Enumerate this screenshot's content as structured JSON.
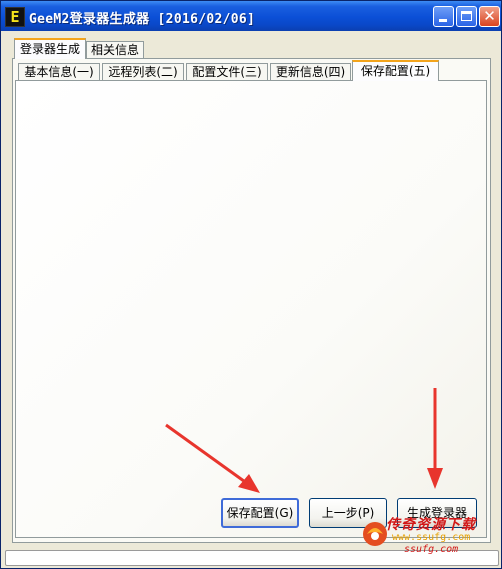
{
  "window": {
    "title": "GeeM2登录器生成器 [2016/02/06]",
    "icon_letter": "E",
    "minimize_glyph": "",
    "maximize_glyph": "",
    "close_glyph": "✕"
  },
  "outer_tabs": [
    {
      "label": "登录器生成",
      "active": true
    },
    {
      "label": "相关信息",
      "active": false
    }
  ],
  "inner_tabs": [
    {
      "label": "基本信息(一)",
      "active": false
    },
    {
      "label": "远程列表(二)",
      "active": false
    },
    {
      "label": "配置文件(三)",
      "active": false
    },
    {
      "label": "更新信息(四)",
      "active": false
    },
    {
      "label": "保存配置(五)",
      "active": true
    }
  ],
  "buttons": {
    "save": "保存配置(G)",
    "prev": "上一步(P)",
    "generate": "生成登录器"
  },
  "watermark": {
    "text": "传奇资源下载",
    "url": "www.ssufg.com",
    "url2": "ssufg.com"
  },
  "colors": {
    "titlebar": "#0b4fd6",
    "active_tab_accent": "#f3a41c",
    "arrow": "#e8352d",
    "watermark_red": "#d21818"
  }
}
